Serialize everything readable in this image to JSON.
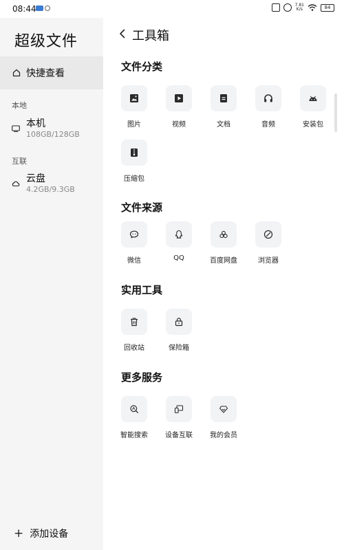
{
  "status_bar": {
    "time": "08:44",
    "net_speed_value": "7.81",
    "net_speed_unit": "K/s",
    "battery": "84"
  },
  "sidebar": {
    "title": "超级文件",
    "quick_view": "快捷查看",
    "local_section": "本地",
    "local_item": {
      "name": "本机",
      "capacity": "108GB/128GB"
    },
    "interconnect_section": "互联",
    "cloud_item": {
      "name": "云盘",
      "capacity": "4.2GB/9.3GB"
    },
    "add_device": "添加设备"
  },
  "main": {
    "title": "工具箱",
    "groups": [
      {
        "title": "文件分类",
        "items": [
          "图片",
          "视频",
          "文档",
          "音频",
          "安装包",
          "压缩包"
        ]
      },
      {
        "title": "文件来源",
        "items": [
          "微信",
          "QQ",
          "百度网盘",
          "浏览器"
        ]
      },
      {
        "title": "实用工具",
        "items": [
          "回收站",
          "保险箱"
        ]
      },
      {
        "title": "更多服务",
        "items": [
          "智能搜索",
          "设备互联",
          "我的会员"
        ]
      }
    ]
  },
  "colors": {
    "sidebar_bg": "#f5f5f5",
    "selected_bg": "#e9e9e9",
    "tile_bg": "#f2f3f5",
    "icon_color": "#2b2b2b"
  }
}
